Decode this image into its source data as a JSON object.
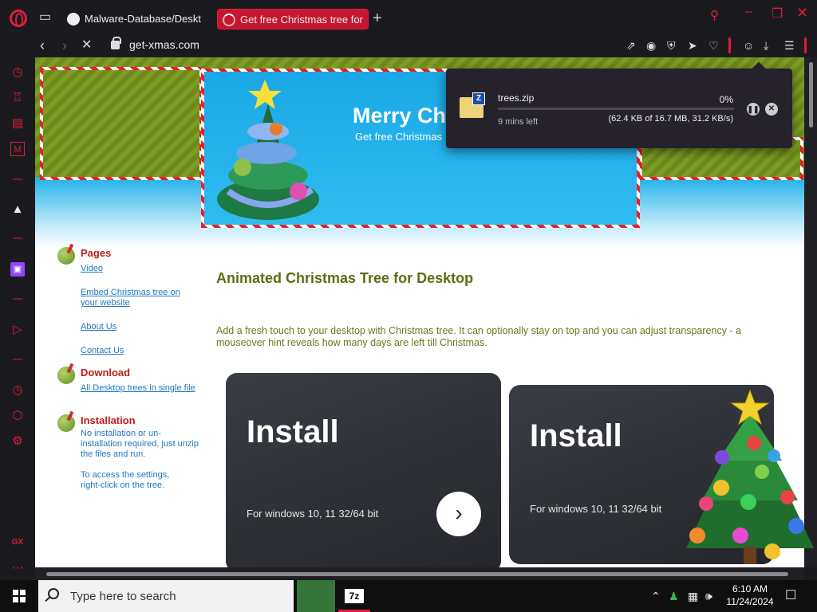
{
  "browser": {
    "tabs": [
      {
        "label": "Malware-Database/Deskt"
      },
      {
        "label": "Get free Christmas tree for"
      }
    ],
    "url": "get-xmas.com"
  },
  "site": {
    "banner_title": "Merry Chr",
    "banner_subtitle": "Get free Christmas",
    "nav": {
      "pages_title": "Pages",
      "pages_links": [
        "Video",
        "Embed Christmas tree on your website",
        "About Us",
        "Contact Us"
      ],
      "download_title": "Download",
      "download_link": "All Desktop trees in single file",
      "install_title": "Installation",
      "install_text_1": "No installation or un-installation required, just unzip the files and run.",
      "install_text_2": "To access the settings, right-click on the tree."
    },
    "main_title": "Animated Christmas Tree for Desktop",
    "main_desc": "Add a fresh touch to your desktop with Christmas tree. It can optionally stay on top and you can adjust transparency - a mouseover hint reveals how many days are left till Christmas.",
    "cards": [
      {
        "title": "Install",
        "subtitle": "For windows 10, 11 32/64 bit",
        "button_icon": "chevron-right-icon"
      },
      {
        "title": "Install",
        "subtitle": "For windows 10, 11 32/64 bit"
      }
    ]
  },
  "download": {
    "filename": "trees.zip",
    "percent": "0%",
    "progress": 0.0,
    "eta": "9 mins left",
    "stats": "(62.4 KB of 16.7 MB, 31.2 KB/s)"
  },
  "taskbar": {
    "search_placeholder": "Type here to search",
    "app_badge": "7z",
    "time": "6:10 AM",
    "date": "11/24/2024"
  },
  "colors": {
    "accent": "#e01b3c",
    "tab_active": "#c5162f",
    "section_title": "#c01b1b",
    "link": "#1f78c1",
    "heading": "#5b6e13"
  }
}
